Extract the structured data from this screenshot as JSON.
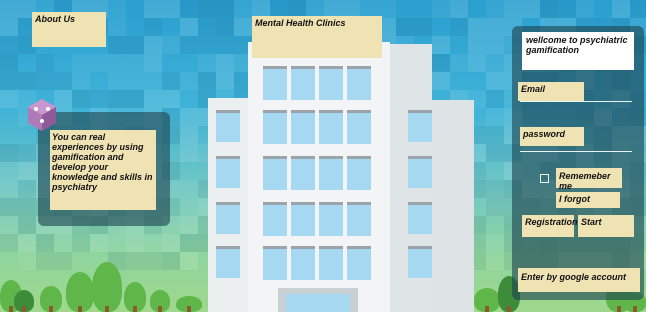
{
  "about": {
    "label": "About Us"
  },
  "clinics": {
    "label": "Mental Health  Clinics"
  },
  "intro": {
    "text": "You can real experiences by using gamification  and develop your knowledge and skills in psychiatry"
  },
  "login": {
    "welcome": "wellcome to psychiatric gamification",
    "email_label": "Email",
    "password_label": "password",
    "remember_label": "Rememeber me",
    "forgot_label": "I forgot",
    "registration_label": "Registration",
    "start_label": "Start",
    "google_label": "Enter by google account"
  },
  "icons": {
    "logo": "purple-cube-logo-icon"
  },
  "colors": {
    "note": "#efe3b4",
    "panel": "rgba(30,70,80,0.62)",
    "window": "#a7d8f1"
  }
}
